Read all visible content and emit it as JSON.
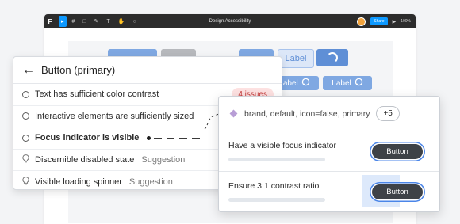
{
  "app": {
    "logo": "F",
    "title": "Design Accessibility",
    "share_label": "Share",
    "zoom": "100%"
  },
  "toolbar_icons": [
    "move-tool-icon",
    "frame-tool-icon",
    "shape-tool-icon",
    "pen-tool-icon",
    "text-tool-icon",
    "hand-tool-icon",
    "comment-tool-icon"
  ],
  "canvas": {
    "buttons": [
      {
        "label": "",
        "style": "blue"
      },
      {
        "label": "",
        "style": "grey"
      },
      {
        "label": "",
        "style": "blue"
      },
      {
        "label": "Label",
        "style": "outline"
      },
      {
        "label": "",
        "style": "spinner"
      },
      {
        "label": "Label",
        "style": "blue"
      },
      {
        "label": "Label",
        "style": "blue"
      }
    ]
  },
  "checklist": {
    "title": "Button (primary)",
    "items": [
      {
        "label": "Text has sufficient color contrast",
        "type": "radio",
        "badge": "4 issues"
      },
      {
        "label": "Interactive elements are sufficiently sized",
        "type": "radio"
      },
      {
        "label": "Focus indicator is visible",
        "type": "radio"
      },
      {
        "label": "Discernible disabled state",
        "type": "bulb",
        "tag": "Suggestion"
      },
      {
        "label": "Visible loading spinner",
        "type": "bulb",
        "tag": "Suggestion"
      }
    ]
  },
  "detail": {
    "variant": "brand, default, icon=false, primary",
    "more": "+5",
    "rows": [
      {
        "label": "Have a visible focus indicator",
        "button": "Button"
      },
      {
        "label": "Ensure 3:1 contrast ratio",
        "button": "Button"
      }
    ]
  },
  "colors": {
    "accent": "#0d99ff",
    "canvas_button": "#7fa8e2",
    "issue_bg": "#fde1e1",
    "issue_text": "#c43b3b",
    "focus_ring": "#4b86e8"
  }
}
